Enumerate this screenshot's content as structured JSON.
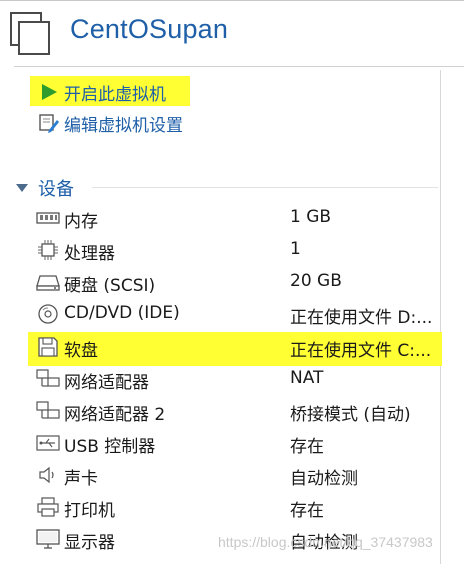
{
  "vm": {
    "title": "CentOSupan"
  },
  "actions": [
    {
      "label": "开启此虚拟机",
      "icon": "play-icon"
    },
    {
      "label": "编辑虚拟机设置",
      "icon": "edit-settings-icon"
    }
  ],
  "devices": {
    "section_label": "设备",
    "items": [
      {
        "name": "内存",
        "value": "1 GB",
        "icon": "memory-icon"
      },
      {
        "name": "处理器",
        "value": "1",
        "icon": "processor-icon"
      },
      {
        "name": "硬盘 (SCSI)",
        "value": "20 GB",
        "icon": "hard-disk-icon"
      },
      {
        "name": "CD/DVD (IDE)",
        "value": "正在使用文件 D:...",
        "icon": "cd-dvd-icon"
      },
      {
        "name": "软盘",
        "value": "正在使用文件 C:...",
        "icon": "floppy-icon"
      },
      {
        "name": "网络适配器",
        "value": "NAT",
        "icon": "network-adapter-icon"
      },
      {
        "name": "网络适配器 2",
        "value": "桥接模式 (自动)",
        "icon": "network-adapter-icon"
      },
      {
        "name": "USB 控制器",
        "value": "存在",
        "icon": "usb-icon"
      },
      {
        "name": "声卡",
        "value": "自动检测",
        "icon": "sound-icon"
      },
      {
        "name": "打印机",
        "value": "存在",
        "icon": "printer-icon"
      },
      {
        "name": "显示器",
        "value": "自动检测",
        "icon": "display-icon"
      }
    ]
  },
  "watermark": "https://blog.csdn.net/qq_37437983",
  "colors": {
    "link": "#1f5fa8",
    "highlight": "#ffff33",
    "play": "#2e9d2e"
  }
}
